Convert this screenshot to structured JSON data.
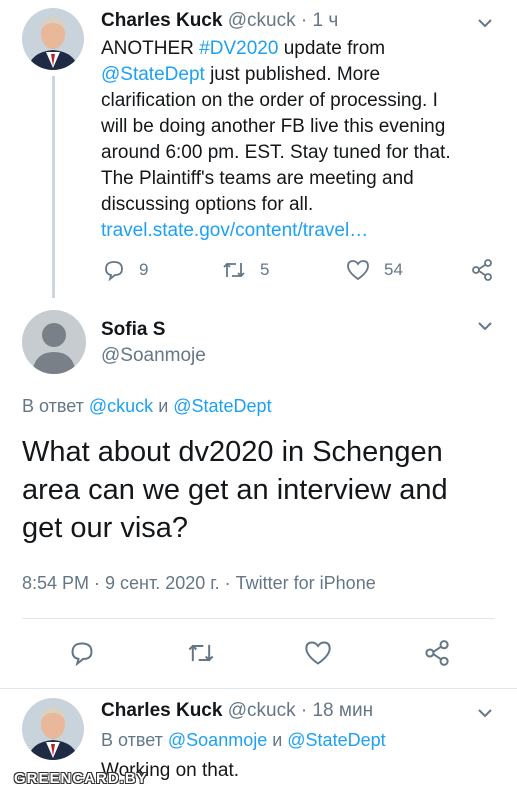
{
  "tweet1": {
    "name": "Charles Kuck",
    "handle": "@ckuck",
    "sep": " · ",
    "time": "1 ч",
    "lines": [
      {
        "pre": "ANOTHER ",
        "link": "#DV2020",
        "post": " update from"
      },
      {
        "pre": "",
        "link": "@StateDept",
        "post": " just published.  More"
      },
      {
        "pre": "clarification on the order of processing. I",
        "link": "",
        "post": ""
      },
      {
        "pre": "will be doing another FB live this evening",
        "link": "",
        "post": ""
      },
      {
        "pre": "around 6:00 pm. EST.  Stay tuned for that.",
        "link": "",
        "post": ""
      },
      {
        "pre": "The Plaintiff's teams are meeting and",
        "link": "",
        "post": ""
      },
      {
        "pre": "discussing options for all.",
        "link": "",
        "post": ""
      },
      {
        "pre": "",
        "link": "travel.state.gov/content/travel…",
        "post": ""
      }
    ],
    "replies": "9",
    "retweets": "5",
    "likes": "54"
  },
  "tweet2": {
    "name": "Sofia S",
    "handle": "@Soanmoje",
    "reply_prefix": "В ответ ",
    "reply_user1": "@ckuck",
    "reply_and": " и ",
    "reply_user2": "@StateDept",
    "text": "What about dv2020 in Schengen area can we get an interview and get our visa?",
    "timestamp": "8:54 PM · 9 сент. 2020 г. · ",
    "source": "Twitter for iPhone"
  },
  "tweet3": {
    "name": "Charles Kuck",
    "handle": "@ckuck",
    "sep": " · ",
    "time": "18 мин",
    "reply_prefix": "В ответ ",
    "reply_user1": "@Soanmoje",
    "reply_and": " и ",
    "reply_user2": "@StateDept",
    "text": "Working on that."
  },
  "watermark": "GREENCARD.BY",
  "colors": {
    "link": "#1da1f2",
    "muted": "#657786",
    "text": "#14171a"
  },
  "icons": [
    "chevron-down-icon",
    "reply-icon",
    "retweet-icon",
    "like-icon",
    "share-icon"
  ]
}
